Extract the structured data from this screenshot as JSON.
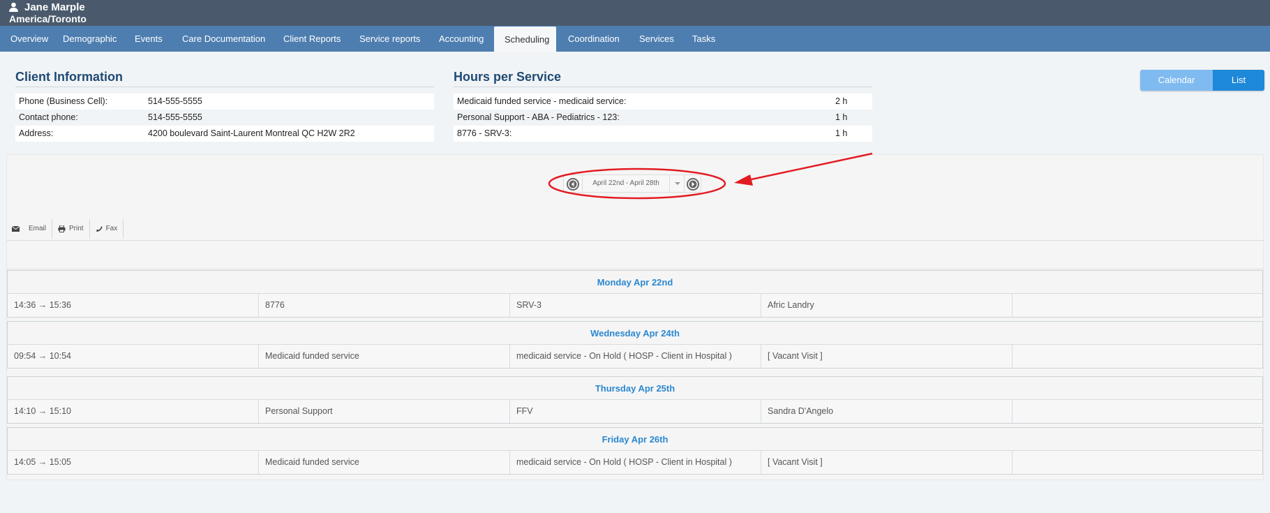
{
  "user": {
    "name": "Jane Marple",
    "timezone": "America/Toronto"
  },
  "tabs": [
    "Overview",
    "Demographic",
    "Events",
    "Care Documentation",
    "Client Reports",
    "Service reports",
    "Accounting",
    "Scheduling",
    "Coordination",
    "Services",
    "Tasks"
  ],
  "active_tab": "Scheduling",
  "client_info": {
    "title": "Client Information",
    "rows": [
      {
        "label": "Phone (Business Cell):",
        "value": "514-555-5555"
      },
      {
        "label": "Contact phone:",
        "value": "514-555-5555"
      },
      {
        "label": "Address:",
        "value": "4200 boulevard Saint-Laurent Montreal QC H2W 2R2"
      }
    ]
  },
  "hours_per_service": {
    "title": "Hours per Service",
    "rows": [
      {
        "label": "Medicaid funded service - medicaid service:",
        "value": "2 h"
      },
      {
        "label": "Personal Support - ABA - Pediatrics - 123:",
        "value": "1 h"
      },
      {
        "label": "8776 - SRV-3:",
        "value": "1 h"
      }
    ]
  },
  "view_toggle": {
    "calendar_label": "Calendar View",
    "list_label": "List View",
    "selected": "List View"
  },
  "date_range": {
    "label": "April 22nd - April 28th"
  },
  "toolbar": {
    "email_label": "Email",
    "print_label": "Print",
    "fax_label": "Fax"
  },
  "schedule": [
    {
      "day": "Monday Apr 22nd",
      "visits": [
        {
          "time": "14:36 → 15:36",
          "service": "8776",
          "detail": "SRV-3",
          "worker": "Afric Landry",
          "extra": ""
        }
      ]
    },
    {
      "day": "Wednesday Apr 24th",
      "visits": [
        {
          "time": "09:54 → 10:54",
          "service": "Medicaid funded service",
          "detail": "medicaid service - On Hold ( HOSP - Client in Hospital )",
          "worker": "[ Vacant Visit ]",
          "extra": ""
        }
      ]
    },
    {
      "day": "Thursday Apr 25th",
      "visits": [
        {
          "time": "14:10 → 15:10",
          "service": "Personal Support",
          "detail": "FFV",
          "worker": "Sandra D'Angelo",
          "extra": ""
        }
      ]
    },
    {
      "day": "Friday Apr 26th",
      "visits": [
        {
          "time": "14:05 → 15:05",
          "service": "Medicaid funded service",
          "detail": "medicaid service - On Hold ( HOSP - Client in Hospital )",
          "worker": "[ Vacant Visit ]",
          "extra": ""
        }
      ]
    }
  ],
  "colors": {
    "topbar": "#4a5a6c",
    "tabbar": "#4e7eb0",
    "accent_blue": "#2a88d0",
    "list_view_button": "#1e88d9",
    "calendar_view_button": "#7fbaf0",
    "annotation_red": "#e31c23"
  },
  "icons": {
    "user": "user-icon",
    "prev": "arrow-left-circle-icon",
    "next": "arrow-right-circle-icon",
    "dropdown": "caret-down-icon",
    "email": "envelope-icon",
    "print": "printer-icon",
    "fax": "phone-icon"
  }
}
